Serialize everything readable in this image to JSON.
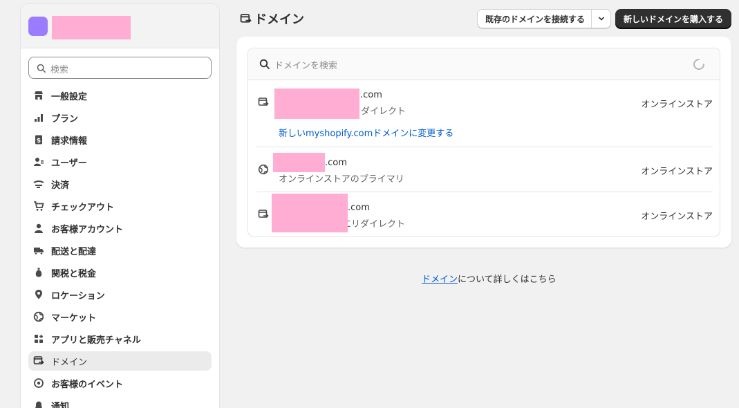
{
  "colors": {
    "accent": "#005bd3",
    "avatar": "#9b7cff",
    "redaction": "#ffadd2",
    "primary_button": "#303030"
  },
  "sidebar": {
    "search": {
      "placeholder": "検索"
    },
    "items": [
      {
        "label": "一般設定",
        "icon": "store-icon"
      },
      {
        "label": "プラン",
        "icon": "plan-chart-icon"
      },
      {
        "label": "請求情報",
        "icon": "billing-icon"
      },
      {
        "label": "ユーザー",
        "icon": "users-icon"
      },
      {
        "label": "決済",
        "icon": "payment-icon"
      },
      {
        "label": "チェックアウト",
        "icon": "cart-icon"
      },
      {
        "label": "お客様アカウント",
        "icon": "person-icon"
      },
      {
        "label": "配送と配達",
        "icon": "truck-icon"
      },
      {
        "label": "関税と税金",
        "icon": "tax-bag-icon"
      },
      {
        "label": "ロケーション",
        "icon": "location-pin-icon"
      },
      {
        "label": "マーケット",
        "icon": "globe-icon"
      },
      {
        "label": "アプリと販売チャネル",
        "icon": "apps-icon"
      },
      {
        "label": "ドメイン",
        "icon": "domain-icon",
        "active": true
      },
      {
        "label": "お客様のイベント",
        "icon": "events-icon"
      },
      {
        "label": "通知",
        "icon": "bell-icon"
      }
    ]
  },
  "header": {
    "title": "ドメイン",
    "connect_button": "既存のドメインを接続する",
    "buy_button": "新しいドメインを購入する"
  },
  "domains": {
    "search_placeholder": "ドメインを検索",
    "rows": [
      {
        "domain_suffix": ".com",
        "subtitle": "リダイレクト",
        "channel": "オンラインストア",
        "icon": "redirect-icon",
        "link": "新しいmyshopify.comドメインに変更する"
      },
      {
        "domain_suffix": ".com",
        "subtitle": "オンラインストアのプライマリ",
        "channel": "オンラインストア",
        "icon": "globe-icon"
      },
      {
        "domain_suffix": ".com",
        "subtitle": "にリダイレクト",
        "channel": "オンラインストア",
        "icon": "redirect-icon"
      }
    ]
  },
  "footer": {
    "link": "ドメイン",
    "text": "について詳しくはこちら"
  }
}
